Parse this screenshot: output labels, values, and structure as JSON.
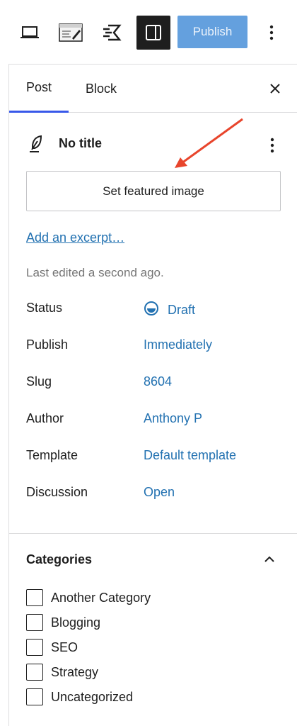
{
  "toolbar": {
    "desktop_icon": "desktop-preview-icon",
    "edit_icon": "edit-icon",
    "jetpack_icon": "jetpack-icon",
    "sidebar_icon": "sidebar-toggle-icon",
    "publish_label": "Publish",
    "more_icon": "more-vertical-icon"
  },
  "tabs": {
    "post_label": "Post",
    "block_label": "Block",
    "close_icon": "close-icon"
  },
  "summary": {
    "title": "No title",
    "title_icon": "feather-icon",
    "featured_image_label": "Set featured image",
    "excerpt_link": "Add an excerpt…",
    "last_edited": "Last edited a second ago."
  },
  "meta": [
    {
      "label": "Status",
      "value": "Draft"
    },
    {
      "label": "Publish",
      "value": "Immediately"
    },
    {
      "label": "Slug",
      "value": "8604"
    },
    {
      "label": "Author",
      "value": "Anthony P"
    },
    {
      "label": "Template",
      "value": "Default template"
    },
    {
      "label": "Discussion",
      "value": "Open"
    }
  ],
  "categories": {
    "heading": "Categories",
    "items": [
      "Another Category",
      "Blogging",
      "SEO",
      "Strategy",
      "Uncategorized"
    ]
  },
  "colors": {
    "accent": "#2271b1",
    "publish_bg": "#4a90d9",
    "tab_indicator": "#3858e9",
    "annotation_arrow": "#e8452c"
  }
}
